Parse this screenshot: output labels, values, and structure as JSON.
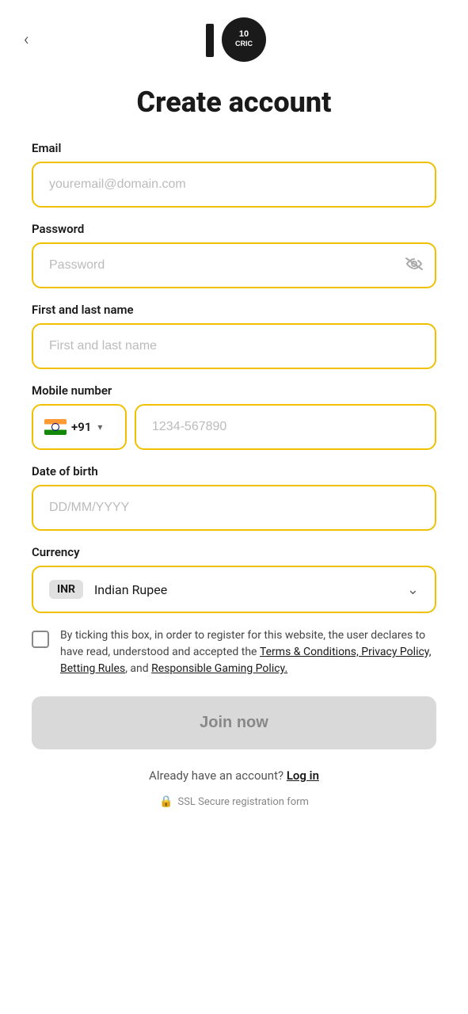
{
  "header": {
    "back_label": "‹",
    "logo_text": "10CRIC"
  },
  "page": {
    "title": "Create account"
  },
  "form": {
    "email": {
      "label": "Email",
      "placeholder": "youremail@domain.com"
    },
    "password": {
      "label": "Password",
      "placeholder": "Password"
    },
    "name": {
      "label": "First and last name",
      "placeholder": "First and last name"
    },
    "mobile": {
      "label": "Mobile number",
      "country_code": "+91",
      "placeholder": "1234-567890"
    },
    "dob": {
      "label": "Date of birth",
      "placeholder": "DD/MM/YYYY"
    },
    "currency": {
      "label": "Currency",
      "badge": "INR",
      "value": "Indian Rupee"
    }
  },
  "terms": {
    "text_before": "By ticking this box, in order to register for this website, the user declares to have read, understood and accepted the ",
    "link_text": "Terms & Conditions, Privacy Policy, Betting Rules",
    "text_between": ", and ",
    "link_text2": "Responsible Gaming Policy."
  },
  "join_button": {
    "label": "Join now"
  },
  "footer": {
    "login_text": "Already have an account?",
    "login_link": "Log in",
    "ssl_text": "SSL Secure registration form"
  }
}
